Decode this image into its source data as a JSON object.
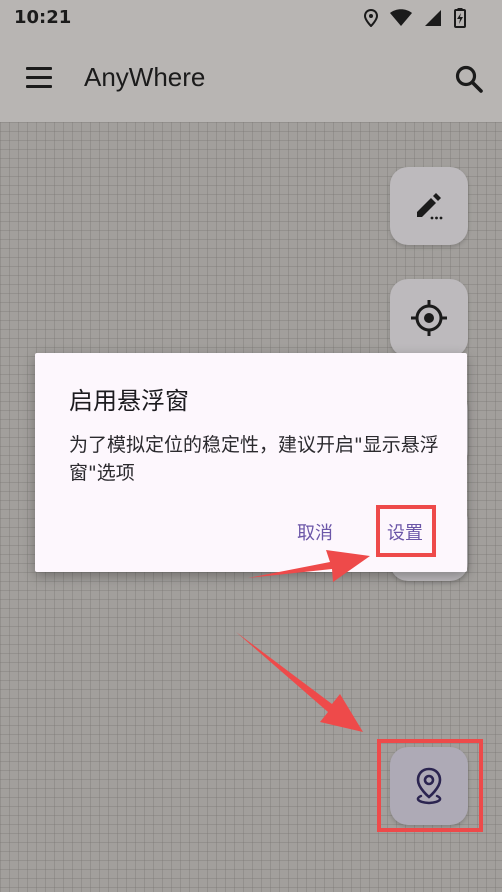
{
  "status_bar": {
    "time": "10:21",
    "icons": [
      "location-icon",
      "wifi-icon",
      "signal-icon",
      "battery-charging-icon"
    ]
  },
  "app_bar": {
    "title": "AnyWhere",
    "menu_icon": "menu-icon",
    "search_icon": "search-icon"
  },
  "fabs": [
    {
      "name": "edit",
      "icon": "edit-pencil-icon"
    },
    {
      "name": "target",
      "icon": "crosshair-target-icon"
    },
    {
      "name": "location",
      "icon": "map-pin-icon"
    }
  ],
  "dialog": {
    "title": "启用悬浮窗",
    "message": "为了模拟定位的稳定性，建议开启\"显示悬浮窗\"选项",
    "cancel_label": "取消",
    "settings_label": "设置"
  },
  "annotation": {
    "highlight_color": "#ee4a4a"
  },
  "colors": {
    "accent": "#6b56a8",
    "app_bar": "#b8b5b3",
    "map_background": "#a29f9c",
    "fab": "#bdbabd"
  }
}
